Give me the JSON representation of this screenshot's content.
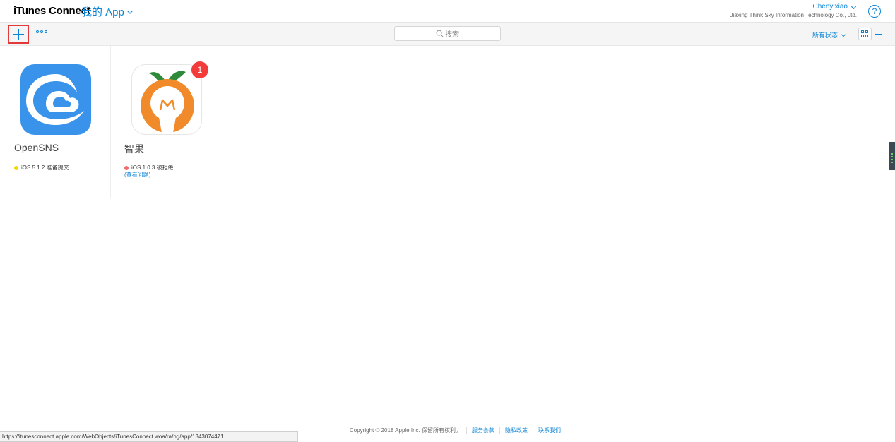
{
  "header": {
    "brand": "iTunes Connect",
    "section": "我的 App",
    "account_name": "Chenyixiao",
    "account_org": "Jiaxing Think Sky Information Technology Co., Ltd.",
    "help_label": "?"
  },
  "toolbar": {
    "search_placeholder": "搜索",
    "filter_label": "所有状态"
  },
  "apps": [
    {
      "name": "OpenSNS",
      "platform": "iOS",
      "version": "5.1.2",
      "status": "准备提交",
      "status_color": "#f5d800",
      "icon": "cloud-swirl-icon"
    },
    {
      "name": "智果",
      "platform": "iOS",
      "version": "1.0.3",
      "status": "被拒绝",
      "status_color": "#f06b6b",
      "link": "(查看问题)",
      "badge": "1",
      "icon": "orange-fruit-icon"
    }
  ],
  "footer": {
    "copyright": "Copyright © 2018 Apple Inc. 保留所有权利。",
    "links": [
      "服务条款",
      "隐私政策",
      "联系我们"
    ]
  },
  "status_url": "https://itunesconnect.apple.com/WebObjects/iTunesConnect.woa/ra/ng/app/1343074471",
  "colors": {
    "accent": "#0a84d6",
    "highlight_border": "#e23a3a",
    "badge": "#f33b3b"
  }
}
